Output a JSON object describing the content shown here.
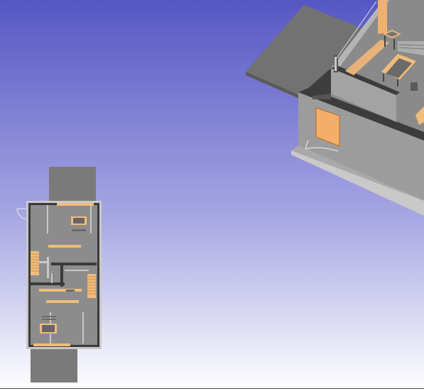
{
  "scene": {
    "background": {
      "top_color": "#5656c4",
      "mid_color": "#a6a6e3",
      "bottom_color": "#ffffff"
    },
    "colors": {
      "slab": "#8f8f8f",
      "slab_dark": "#6b6b6b",
      "wall_top": "#3c3c3c",
      "floor": "#7e7e7e",
      "furniture_wood": "#f0bc7c",
      "door_wood": "#f3ae6a",
      "interior_floor": "#9a9a9a",
      "frame": "#c9c9c9"
    }
  },
  "views": {
    "perspective": {
      "label": "3d-view"
    },
    "plan": {
      "label": "plan-view"
    }
  }
}
